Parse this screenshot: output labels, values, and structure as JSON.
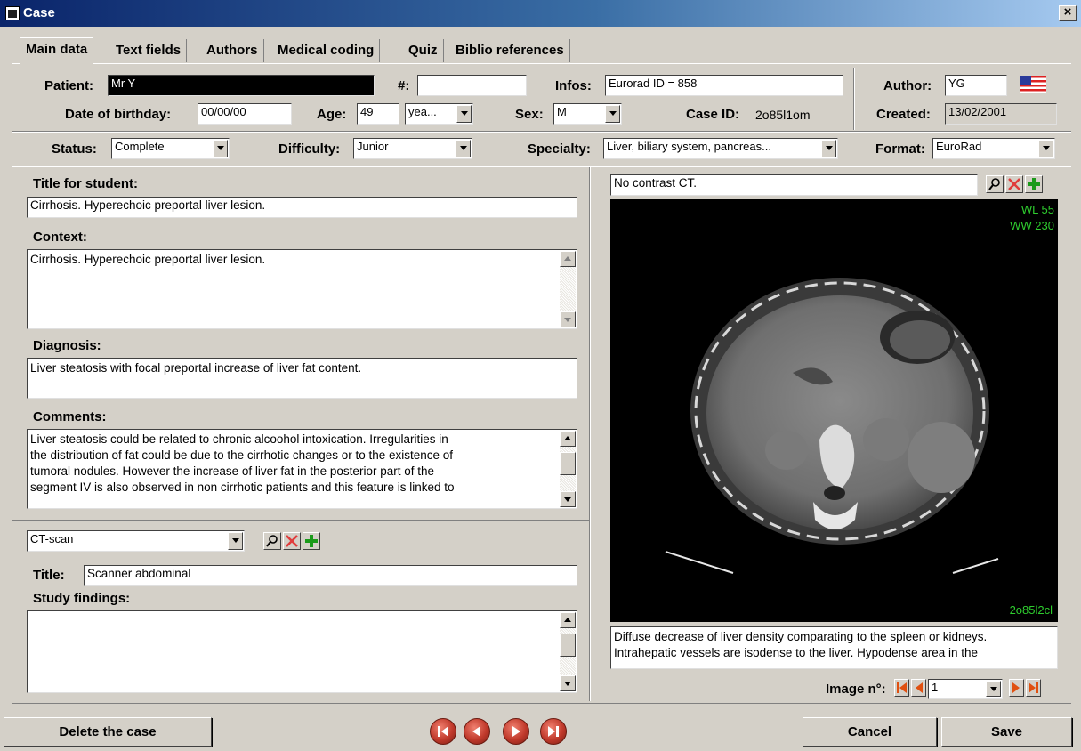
{
  "window": {
    "title": "Case",
    "close_glyph": "×"
  },
  "tabs": [
    {
      "label": "Main data",
      "active": true
    },
    {
      "label": "Text fields"
    },
    {
      "label": "Authors"
    },
    {
      "label": "Medical coding"
    },
    {
      "label": "Quiz"
    },
    {
      "label": "Biblio references"
    }
  ],
  "header": {
    "patient_label": "Patient:",
    "patient_value": "Mr Y",
    "number_label": "#:",
    "number_value": "",
    "infos_label": "Infos:",
    "infos_value": "Eurorad ID = 858",
    "author_label": "Author:",
    "author_value": "YG",
    "dob_label": "Date of birthday:",
    "dob_value": "00/00/00",
    "age_label": "Age:",
    "age_value": "49",
    "age_unit": "yea...",
    "sex_label": "Sex:",
    "sex_value": "M",
    "caseid_label": "Case ID:",
    "caseid_value": "2o85l1om",
    "created_label": "Created:",
    "created_value": "13/02/2001",
    "status_label": "Status:",
    "status_value": "Complete",
    "difficulty_label": "Difficulty:",
    "difficulty_value": "Junior",
    "specialty_label": "Specialty:",
    "specialty_value": "Liver, biliary system, pancreas...",
    "format_label": "Format:",
    "format_value": "EuroRad"
  },
  "left": {
    "title_label": "Title for student:",
    "title_value": "Cirrhosis. Hyperechoic preportal liver lesion.",
    "context_label": "Context:",
    "context_value": "Cirrhosis. Hyperechoic preportal liver lesion.",
    "diagnosis_label": "Diagnosis:",
    "diagnosis_value": "Liver steatosis with focal preportal increase of liver fat content.",
    "comments_label": "Comments:",
    "comments_lines": [
      "Liver steatosis could be related to chronic alcoohol intoxication. Irregularities in",
      "the distribution of fat could be due to the cirrhotic changes or to the existence of",
      "tumoral nodules. However the increase of liver fat in the posterior part of the",
      "segment IV is also observed in non cirrhotic patients and this feature is linked to"
    ],
    "study_type": "CT-scan",
    "study_title_label": "Title:",
    "study_title_value": "Scanner abdominal",
    "findings_label": "Study findings:",
    "findings_value": ""
  },
  "right": {
    "image_caption_title": "No contrast CT.",
    "wl": "WL 55",
    "ww": "WW 230",
    "image_id": "2o85l2cl",
    "description_lines": [
      "Diffuse decrease of liver density comparating to the spleen or kidneys.",
      "Intrahepatic vessels are isodense to the liver. Hypodense area in the"
    ],
    "image_n_label": "Image n°:",
    "image_n_value": "1"
  },
  "footer": {
    "delete_label": "Delete the case",
    "cancel_label": "Cancel",
    "save_label": "Save"
  },
  "colors": {
    "titlebar_start": "#0a246a",
    "titlebar_end": "#a6caf0",
    "nav_red": "#c0392b",
    "ct_overlay_green": "#2ecc2e",
    "dialog_grey": "#d4d0c8"
  },
  "icons": {
    "search": "magnifier-icon",
    "delete": "red-x-icon",
    "add": "green-plus-icon",
    "flag": "us-flag-icon"
  }
}
